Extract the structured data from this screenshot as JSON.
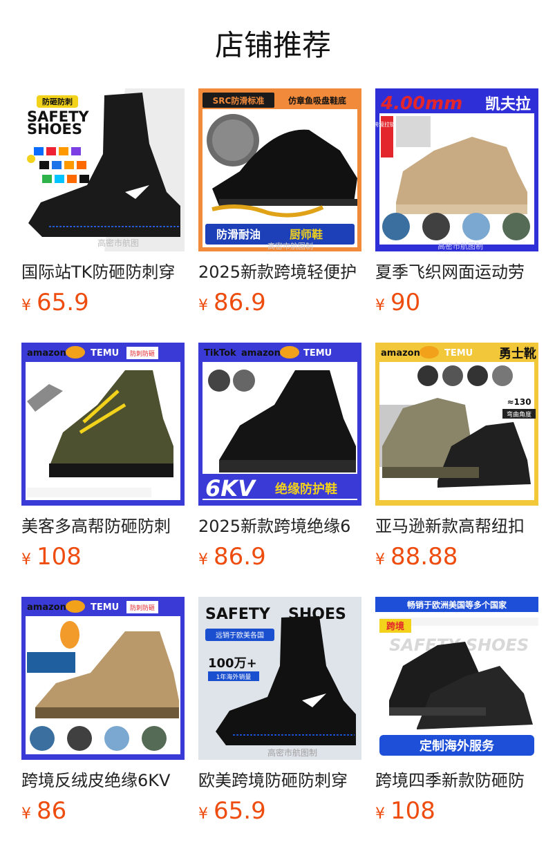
{
  "page_title": "店铺推荐",
  "currency": "¥",
  "products": [
    {
      "name": "国际站TK防砸防刺穿",
      "price": "65.9",
      "image_text": [
        "防砸防刺",
        "SAFETY",
        "SHOES",
        "高密市航图"
      ],
      "palette": {
        "bg": "#ffffff",
        "shoe": "#1a1a1a",
        "accent": "#2a5bd7"
      }
    },
    {
      "name": "2025新款跨境轻便护",
      "price": "86.9",
      "image_text": [
        "SRC防滑标准",
        "仿章鱼吸盘鞋底",
        "防滑耐油",
        "厨师鞋",
        "高密市航图制"
      ],
      "palette": {
        "bg": "#f28a3b",
        "shoe": "#111111",
        "accent": "#1d3fb8"
      }
    },
    {
      "name": "夏季飞织网面运动劳",
      "price": "90",
      "image_text": [
        "4.00mm",
        "凯夫拉",
        "跨境拉链袋",
        "高密市航图制"
      ],
      "palette": {
        "bg": "#2f2fd8",
        "shoe": "#c8ab82",
        "accent": "#e2262b"
      }
    },
    {
      "name": "美客多高帮防砸防刺",
      "price": "108",
      "image_text": [
        "amazon",
        "TEMU",
        "防刺防砸"
      ],
      "palette": {
        "bg": "#3a3ad6",
        "shoe": "#4d5130",
        "accent": "#f2d21a"
      }
    },
    {
      "name": "2025新款跨境绝缘6",
      "price": "86.9",
      "image_text": [
        "TikTok",
        "amazon",
        "TEMU",
        "6KV",
        "绝缘防护鞋"
      ],
      "palette": {
        "bg": "#3a3ad6",
        "shoe": "#141414",
        "accent": "#f2d21a"
      }
    },
    {
      "name": "亚马逊新款高帮纽扣",
      "price": "88.88",
      "image_text": [
        "amazon",
        "TEMU",
        "勇士靴",
        "≈130",
        "弯曲角度"
      ],
      "palette": {
        "bg": "#f3c73a",
        "shoe": "#8a8468",
        "accent": "#222222"
      }
    },
    {
      "name": "跨境反绒皮绝缘6KV",
      "price": "86",
      "image_text": [
        "amazon",
        "TEMU",
        "防刺防砸"
      ],
      "palette": {
        "bg": "#3a3ad6",
        "shoe": "#b9996a",
        "accent": "#f2d21a"
      }
    },
    {
      "name": "欧美跨境防砸防刺穿",
      "price": "65.9",
      "image_text": [
        "SAFETY",
        "SHOES",
        "远销于欧美各国",
        "100万+",
        "1年海外销量",
        "高密市航图制"
      ],
      "palette": {
        "bg": "#dfe3ea",
        "shoe": "#111111",
        "accent": "#1a4fd0"
      }
    },
    {
      "name": "跨境四季新款防砸防",
      "price": "108",
      "image_text": [
        "畅销于欧洲美国等多个国家",
        "跨境",
        "SAFETY SHOES",
        "定制海外服务"
      ],
      "palette": {
        "bg": "#ffffff",
        "shoe": "#1c1c1c",
        "accent": "#1e4fd8"
      }
    }
  ]
}
